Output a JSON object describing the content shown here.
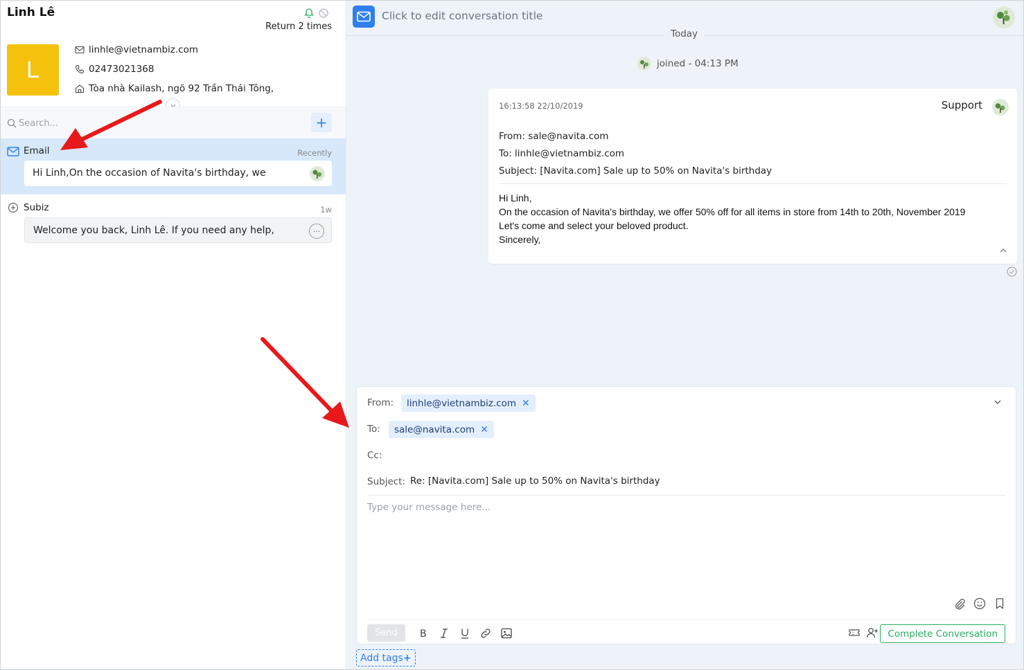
{
  "contact": {
    "name": "Linh Lê",
    "return_text": "Return 2 times",
    "avatar_letter": "L",
    "email": "linhle@vietnambiz.com",
    "phone": "02473021368",
    "address": "Tòa nhà Kailash, ngõ 92 Trần Thái Tông,"
  },
  "search": {
    "placeholder": "Search..."
  },
  "conversations": [
    {
      "channel": "Email",
      "time": "Recently",
      "preview": "Hi Linh,On the occasion of Navita's birthday, we",
      "active": true
    },
    {
      "channel": "Subiz",
      "time": "1w",
      "preview": "Welcome you back, Linh Lê. If you need any help,",
      "active": false
    }
  ],
  "header": {
    "title": "Click to edit conversation title"
  },
  "timeline": {
    "day_label": "Today",
    "joined_text": "joined - 04:13 PM"
  },
  "message": {
    "timestamp": "16:13:58 22/10/2019",
    "sender": "Support",
    "from": "From: sale@navita.com",
    "to": "To: linhle@vietnambiz.com",
    "subject": "Subject: [Navita.com] Sale up to 50% on Navita's birthday",
    "body": [
      "Hi Linh,",
      "On the occasion of Navita's birthday, we offer 50% off for all items in store from 14th to 20th, November 2019",
      "Let's come and select your beloved product.",
      "Sincerely,"
    ]
  },
  "composer": {
    "from_label": "From:",
    "from_value": "linhle@vietnambiz.com",
    "to_label": "To:",
    "to_value": "sale@navita.com",
    "cc_label": "Cc:",
    "subject_label": "Subject:",
    "subject_value": "Re: [Navita.com] Sale up to 50% on Navita's birthday",
    "message_placeholder": "Type your message here...",
    "send_label": "Send",
    "complete_label": "Complete Conversation",
    "add_tags_label": "Add tags"
  },
  "colors": {
    "accent": "#2f80ed",
    "active_row": "#d7e8fb",
    "avatar_bg": "#f4c20d",
    "success": "#27ae60",
    "annotation_arrow": "#e8191b"
  },
  "icons": [
    "bell-icon",
    "block-icon",
    "mail-icon",
    "phone-icon",
    "home-icon",
    "chevron-down-icon",
    "search-icon",
    "plus-icon",
    "chat-icon",
    "more-icon",
    "chevron-up-icon",
    "check-circle-icon",
    "attach-icon",
    "emoji-icon",
    "bookmark-icon",
    "bold-icon",
    "italic-icon",
    "underline-icon",
    "link-icon",
    "image-icon",
    "ticket-icon",
    "assign-user-icon",
    "close-icon"
  ]
}
